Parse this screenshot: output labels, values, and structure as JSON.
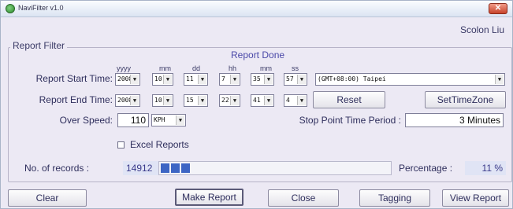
{
  "window": {
    "title": "NaviFilter v1.0",
    "close_glyph": "✕"
  },
  "header": {
    "author": "Scolon Liu"
  },
  "report_filter": {
    "legend": "Report Filter",
    "status": "Report Done",
    "columns": {
      "year": "yyyy",
      "month": "mm",
      "day": "dd",
      "hour": "hh",
      "minute": "mm",
      "second": "ss"
    },
    "start": {
      "label": "Report Start Time:",
      "year": "2008",
      "month": "10",
      "day": "11",
      "hour": "7",
      "minute": "35",
      "second": "57",
      "timezone": "(GMT+08:00) Taipei"
    },
    "end": {
      "label": "Report End Time:",
      "year": "2008",
      "month": "10",
      "day": "15",
      "hour": "22",
      "minute": "41",
      "second": "4"
    },
    "reset_label": "Reset",
    "settimezone_label": "SetTimeZone",
    "over_speed": {
      "label": "Over Speed:",
      "value": "110",
      "unit": "KPH"
    },
    "stop_point": {
      "label": "Stop Point Time Period :",
      "value": "3 Minutes"
    },
    "excel": {
      "label": "Excel Reports",
      "checked": false
    },
    "records": {
      "label": "No. of records :",
      "value": "14912"
    },
    "progress": {
      "filled_segments": 3,
      "percent": 11
    },
    "percentage": {
      "label": "Percentage :",
      "value": "11 %"
    }
  },
  "buttons": {
    "clear": "Clear",
    "make_report": "Make Report",
    "close": "Close",
    "tagging": "Tagging",
    "view_report": "View Report"
  },
  "icons": {
    "dropdown": "▼",
    "app": "navifilter-icon"
  },
  "colors": {
    "progress_fill": "#3d65c4",
    "status_text": "#4a48a8",
    "window_bg": "#ece9f4"
  }
}
